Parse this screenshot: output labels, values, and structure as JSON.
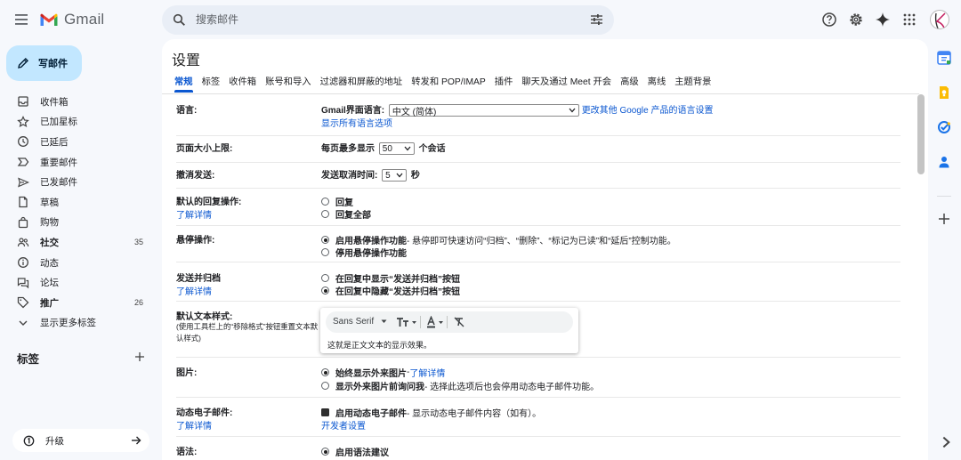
{
  "app": {
    "logo_text": "Gmail"
  },
  "search": {
    "placeholder": "搜索邮件"
  },
  "compose": {
    "label": "写邮件"
  },
  "nav": {
    "items": [
      {
        "label": "收件箱",
        "count": ""
      },
      {
        "label": "已加星标",
        "count": ""
      },
      {
        "label": "已延后",
        "count": ""
      },
      {
        "label": "重要邮件",
        "count": ""
      },
      {
        "label": "已发邮件",
        "count": ""
      },
      {
        "label": "草稿",
        "count": ""
      },
      {
        "label": "购物",
        "count": ""
      },
      {
        "label": "社交",
        "count": "35"
      },
      {
        "label": "动态",
        "count": ""
      },
      {
        "label": "论坛",
        "count": ""
      },
      {
        "label": "推广",
        "count": "26"
      },
      {
        "label": "显示更多标签",
        "count": ""
      }
    ],
    "labels_title": "标签",
    "upgrade_label": "升级"
  },
  "settings": {
    "title": "设置",
    "tabs": [
      "常规",
      "标签",
      "收件箱",
      "账号和导入",
      "过滤器和屏蔽的地址",
      "转发和 POP/IMAP",
      "插件",
      "聊天及通过 Meet 开会",
      "高级",
      "离线",
      "主题背景"
    ],
    "learn_more": "了解详情",
    "language": {
      "label": "语言:",
      "prefix": "Gmail界面语言:",
      "value": "中文 (简体)",
      "change_link": "更改其他 Google 产品的语言设置",
      "show_all": "显示所有语言选项"
    },
    "page_size": {
      "label": "页面大小上限:",
      "prefix": "每页最多显示",
      "value": "50",
      "suffix": "个会话"
    },
    "undo_send": {
      "label": "撤消发送:",
      "prefix": "发送取消时间:",
      "value": "5",
      "suffix": "秒"
    },
    "reply": {
      "label": "默认的回复操作:",
      "opt1": "回复",
      "opt2": "回复全部"
    },
    "hover": {
      "label": "悬停操作:",
      "opt1": "启用悬停操作功能",
      "opt1_desc": " - 悬停即可快速访问“归档”、“删除”、“标记为已读”和“延后”控制功能。",
      "opt2": "停用悬停操作功能"
    },
    "send_archive": {
      "label": "发送并归档",
      "opt1": "在回复中显示“发送并归档”按钮",
      "opt2": "在回复中隐藏“发送并归档”按钮"
    },
    "text_style": {
      "label": "默认文本样式:",
      "note": "(使用工具栏上的“移除格式”按钮重置文本默认样式)",
      "font": "Sans Serif",
      "preview": "这就是正文文本的显示效果。"
    },
    "images": {
      "label": "图片:",
      "opt1": "始终显示外来图片",
      "opt1_sep": " - ",
      "opt1_link": "了解详情",
      "opt2": "显示外来图片前询问我",
      "opt2_desc": " - 选择此选项后也会停用动态电子邮件功能。"
    },
    "dynamic_email": {
      "label": "动态电子邮件:",
      "opt1": "启用动态电子邮件",
      "opt1_desc": " - 显示动态电子邮件内容（如有）。",
      "dev_link": "开发者设置"
    },
    "grammar": {
      "label": "语法:",
      "opt1": "启用语法建议"
    }
  },
  "colors": {
    "accent": "#0b57d0",
    "compose_bg": "#c2e7ff",
    "page_bg": "#f6f8fc"
  }
}
